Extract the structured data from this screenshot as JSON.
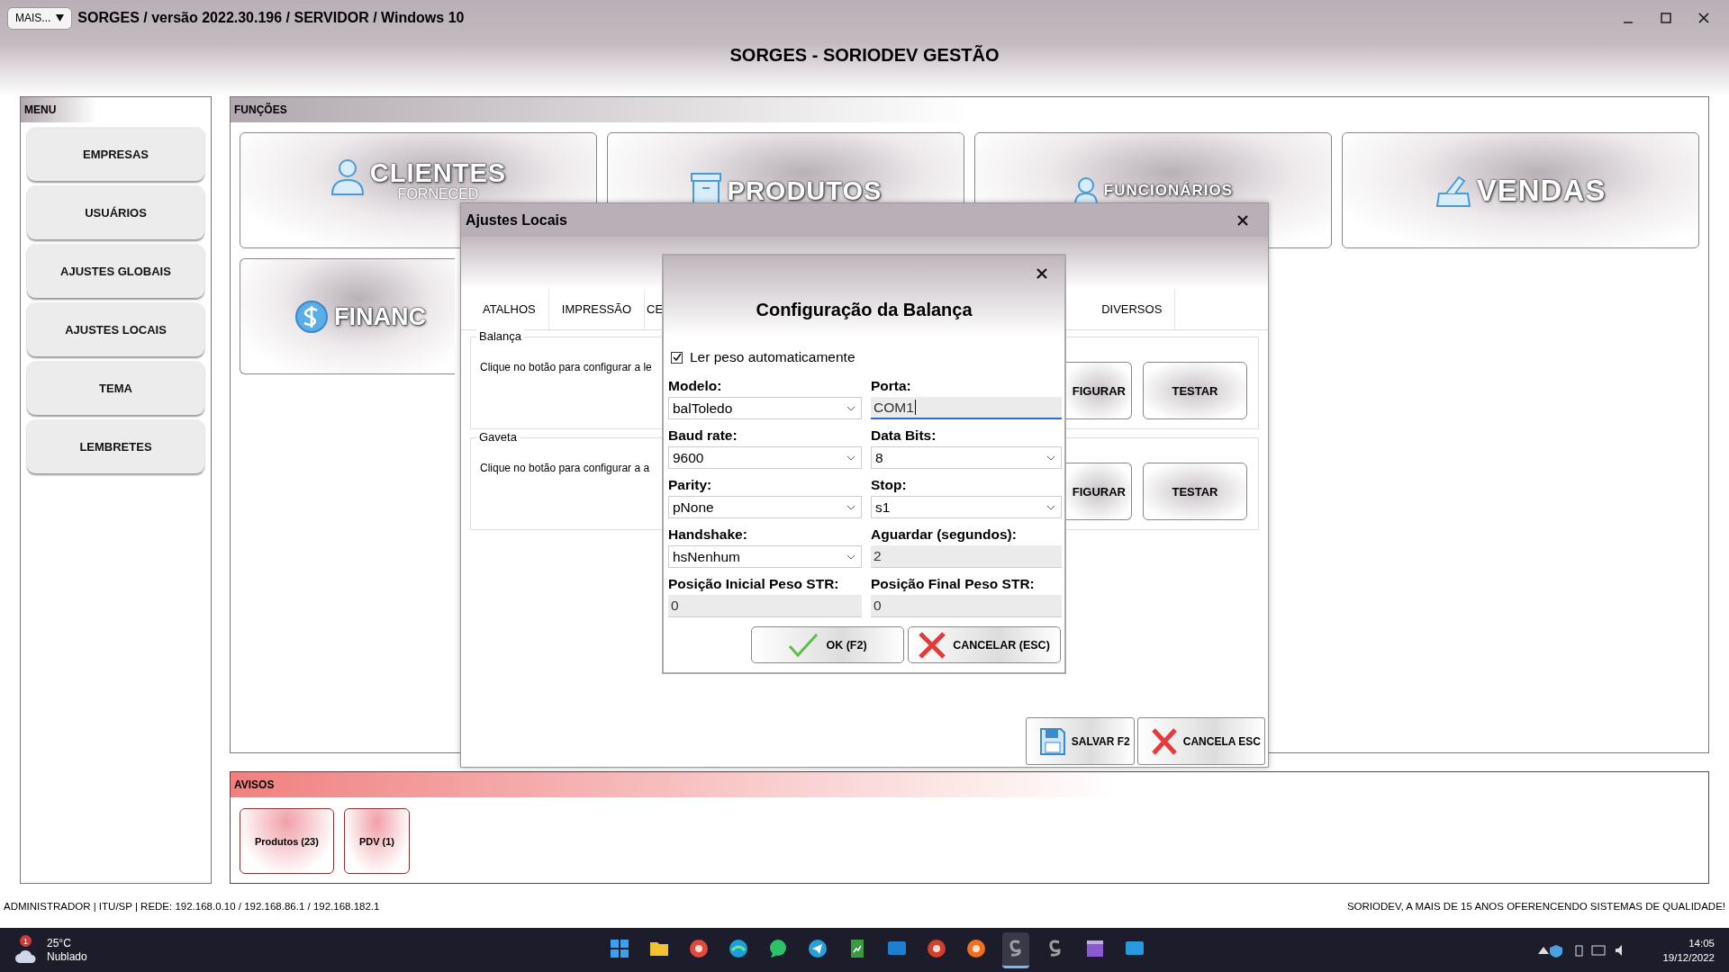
{
  "window": {
    "menu_button": "MAIS...",
    "title": "SORGES / versão 2022.30.196 / SERVIDOR / Windows 10"
  },
  "header": "SORGES - SORIODEV GESTÃO",
  "menu": {
    "title": "MENU",
    "items": [
      "EMPRESAS",
      "USUÁRIOS",
      "AJUSTES GLOBAIS",
      "AJUSTES LOCAIS",
      "TEMA",
      "LEMBRETES"
    ]
  },
  "functions": {
    "title": "FUNÇÕES",
    "cards": [
      {
        "kind": "person",
        "title": "CLIENTES",
        "subtitle": "FORNECED"
      },
      {
        "kind": "box",
        "title": "PRODUTOS"
      },
      {
        "kind": "worker",
        "title": "FUNCIONÁRIOS"
      },
      {
        "kind": "register",
        "title": "VENDAS"
      },
      {
        "kind": "money",
        "title": "FINANC"
      }
    ]
  },
  "notices": {
    "title": "AVISOS",
    "items": [
      "Produtos (23)",
      "PDV (1)"
    ]
  },
  "status": {
    "left": "ADMINISTRADOR |  ITU/SP |  REDE: 192.168.0.10 / 192.168.86.1 / 192.168.182.1",
    "right": "SORIODEV, A MAIS DE 15 ANOS OFERENCENDO SISTEMAS DE QUALIDADE!"
  },
  "local_settings": {
    "title": "Ajustes Locais",
    "tabs": [
      {
        "label": "ATALHOS",
        "selected": false
      },
      {
        "label": "IMPRESSÃO",
        "selected": false
      },
      {
        "label": "CE",
        "selected": false
      },
      {
        "label": "DIVERSOS",
        "selected": false
      }
    ],
    "groups": [
      {
        "legend": "Balança",
        "text": "Clique no botão para configurar a le",
        "buttons": [
          "FIGURAR",
          "TESTAR"
        ]
      },
      {
        "legend": "Gaveta",
        "text": "Clique no botão para configurar a a",
        "buttons": [
          "FIGURAR",
          "TESTAR"
        ]
      }
    ],
    "footer_buttons": [
      {
        "kind": "save",
        "label": "SALVAR F2"
      },
      {
        "kind": "cancel",
        "label": "CANCELA ESC"
      }
    ]
  },
  "scale_dialog": {
    "title": "Configuração da Balança",
    "checkbox": {
      "label": "Ler peso automaticamente",
      "checked": true
    },
    "fields": [
      {
        "label": "Modelo:",
        "kind": "select",
        "value": "balToledo",
        "focused": false
      },
      {
        "label": "Porta:",
        "kind": "input",
        "value": "COM1",
        "focused": true
      },
      {
        "label": "Baud rate:",
        "kind": "select",
        "value": "9600",
        "focused": false
      },
      {
        "label": "Data Bits:",
        "kind": "select",
        "value": "8",
        "focused": false
      },
      {
        "label": "Parity:",
        "kind": "select",
        "value": "pNone",
        "focused": false
      },
      {
        "label": "Stop:",
        "kind": "select",
        "value": "s1",
        "focused": false
      },
      {
        "label": "Handshake:",
        "kind": "select",
        "value": "hsNenhum",
        "focused": false
      },
      {
        "label": "Aguardar (segundos):",
        "kind": "input",
        "value": "2",
        "focused": false
      },
      {
        "label": "Posição Inicial Peso STR:",
        "kind": "input",
        "value": "0",
        "focused": false
      },
      {
        "label": "Posição Final Peso STR:",
        "kind": "input",
        "value": "0",
        "focused": false
      }
    ],
    "buttons": [
      {
        "kind": "ok",
        "label": "OK (F2)"
      },
      {
        "kind": "cancel",
        "label": "CANCELAR (ESC)"
      }
    ]
  },
  "taskbar": {
    "weather": {
      "badge": "1",
      "temperature": "25°C",
      "condition": "Nublado"
    },
    "apps": [
      {
        "kind": "start",
        "active": false
      },
      {
        "kind": "folder",
        "active": false
      },
      {
        "kind": "globe",
        "active": false
      },
      {
        "kind": "wave",
        "active": false
      },
      {
        "kind": "chat",
        "active": false
      },
      {
        "kind": "plane",
        "active": false
      },
      {
        "kind": "sheet",
        "active": false
      },
      {
        "kind": "sync",
        "active": false
      },
      {
        "kind": "round",
        "active": false
      },
      {
        "kind": "fox",
        "active": false
      },
      {
        "kind": "logo",
        "active": true
      },
      {
        "kind": "logo",
        "active": false
      },
      {
        "kind": "clapper",
        "active": false
      },
      {
        "kind": "screen",
        "active": false
      }
    ],
    "time": "14:05",
    "date": "19/12/2022"
  }
}
